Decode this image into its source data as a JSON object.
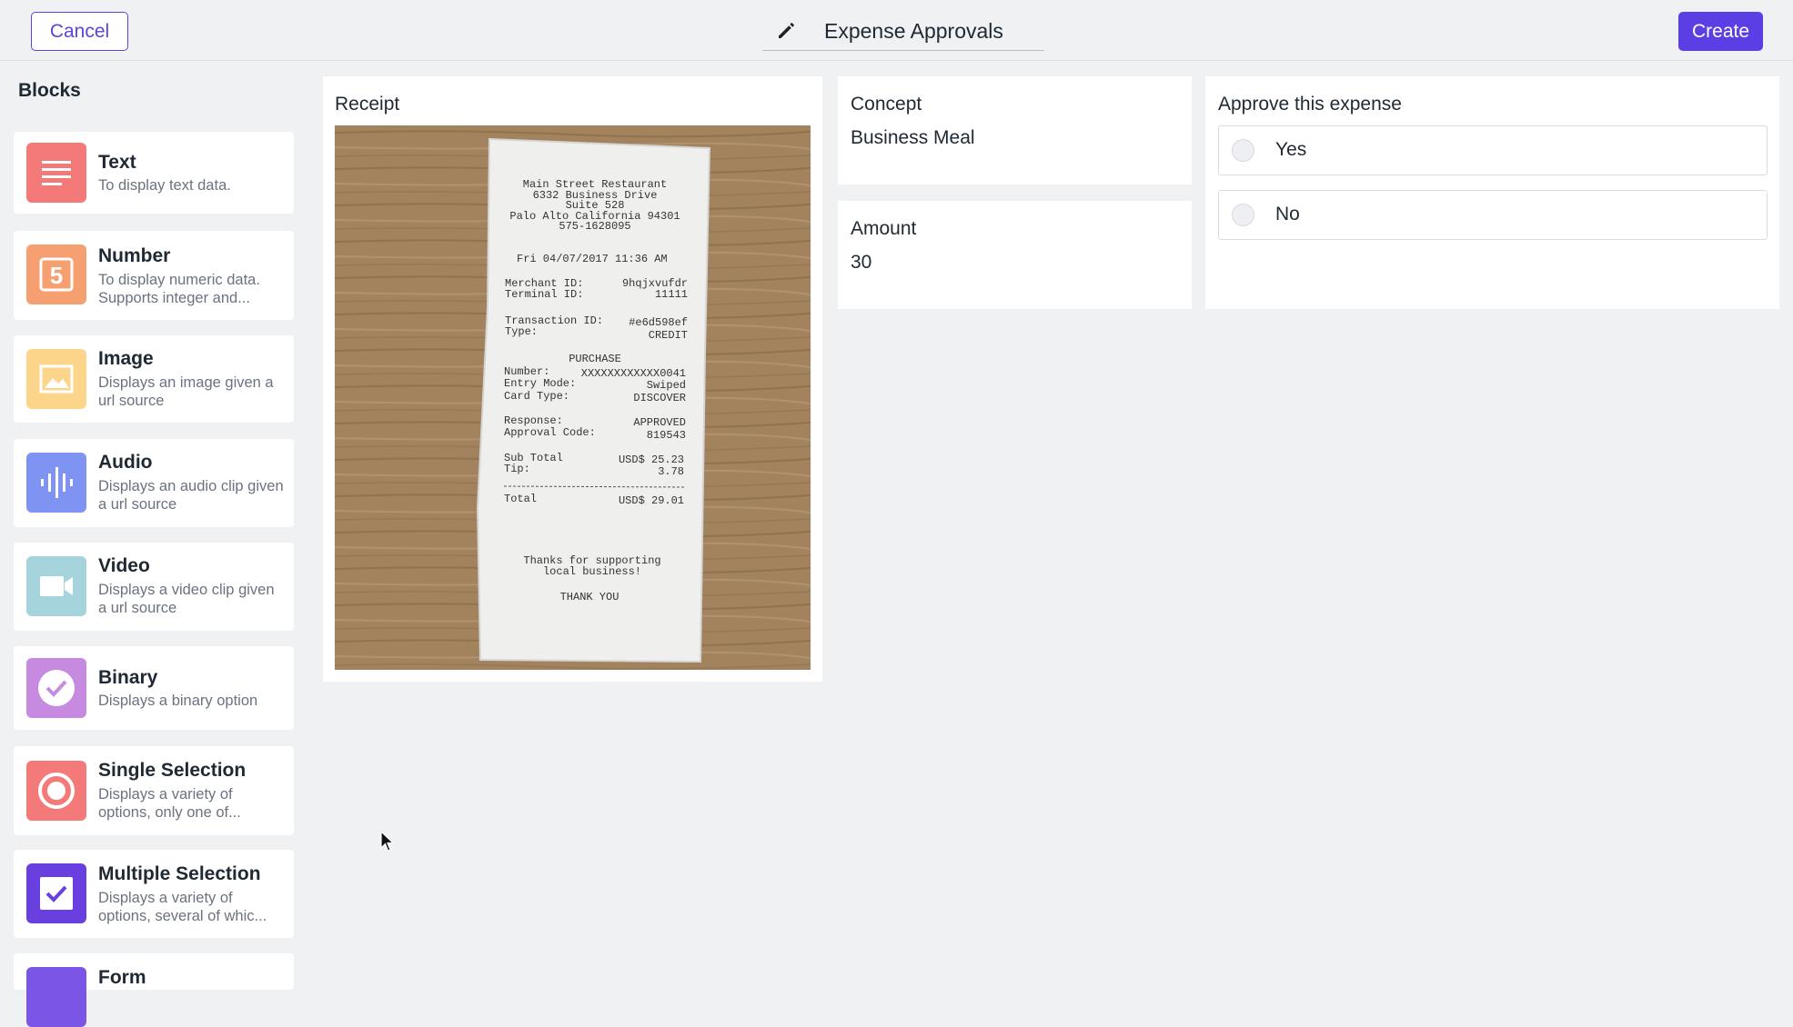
{
  "header": {
    "cancel_label": "Cancel",
    "title": "Expense Approvals",
    "create_label": "Create",
    "accent_color": "#5b3fe4"
  },
  "sidebar": {
    "heading": "Blocks",
    "items": [
      {
        "name": "Text",
        "description": "To display text data.",
        "icon": "text-lines-icon",
        "color": "#f47a7a"
      },
      {
        "name": "Number",
        "description": "To display numeric data. Supports integer and...",
        "icon": "number-five-icon",
        "color": "#f6a071"
      },
      {
        "name": "Image",
        "description": "Displays an image given a url source",
        "icon": "image-icon",
        "color": "#fcd48a"
      },
      {
        "name": "Audio",
        "description": "Displays an audio clip given a url source",
        "icon": "audio-wave-icon",
        "color": "#7f93f3"
      },
      {
        "name": "Video",
        "description": "Displays a video clip given a url source",
        "icon": "video-camera-icon",
        "color": "#a6d4dc"
      },
      {
        "name": "Binary",
        "description": "Displays a binary option",
        "icon": "check-circle-icon",
        "color": "#c68be0"
      },
      {
        "name": "Single Selection",
        "description": "Displays a variety of options, only one of...",
        "icon": "radio-icon",
        "color": "#f47a7a"
      },
      {
        "name": "Multiple Selection",
        "description": "Displays a variety of options, several of whic...",
        "icon": "checkbox-icon",
        "color": "#6a3fe0"
      },
      {
        "name": "Form",
        "description": "",
        "icon": "form-icon",
        "color": "#7a55e6"
      }
    ]
  },
  "receipt": {
    "title": "Receipt",
    "lines": {
      "l1": "Main Street Restaurant",
      "l2": "6332 Business Drive",
      "l3": "Suite 528",
      "l4": "Palo Alto California 94301",
      "l5": "575-1628095",
      "date": "Fri 04/07/2017 11:36 AM",
      "merchant_label": "Merchant ID:",
      "merchant_val": "9hqjxvufdr",
      "terminal_label": "Terminal ID:",
      "terminal_val": "11111",
      "txn_label": "Transaction ID:",
      "txn_val": "#e6d598ef",
      "type_label": "Type:",
      "type_val": "CREDIT",
      "purchase": "PURCHASE",
      "number_label": "Number:",
      "number_val": "XXXXXXXXXXXX0041",
      "entry_label": "Entry Mode:",
      "entry_val": "Swiped",
      "card_label": "Card Type:",
      "card_val": "DISCOVER",
      "response_label": "Response:",
      "response_val": "APPROVED",
      "approval_label": "Approval Code:",
      "approval_val": "819543",
      "subtotal_label": "Sub Total",
      "subtotal_val": "USD$ 25.23",
      "tip_label": "Tip:",
      "tip_val": "3.78",
      "total_label": "Total",
      "total_val": "USD$ 29.01",
      "thanks1": "Thanks for supporting",
      "thanks2": "local business!",
      "thankyou": "THANK YOU"
    }
  },
  "concept": {
    "title": "Concept",
    "value": "Business Meal"
  },
  "amount": {
    "title": "Amount",
    "value": "30"
  },
  "approval": {
    "title": "Approve this expense",
    "options": [
      "Yes",
      "No"
    ]
  }
}
